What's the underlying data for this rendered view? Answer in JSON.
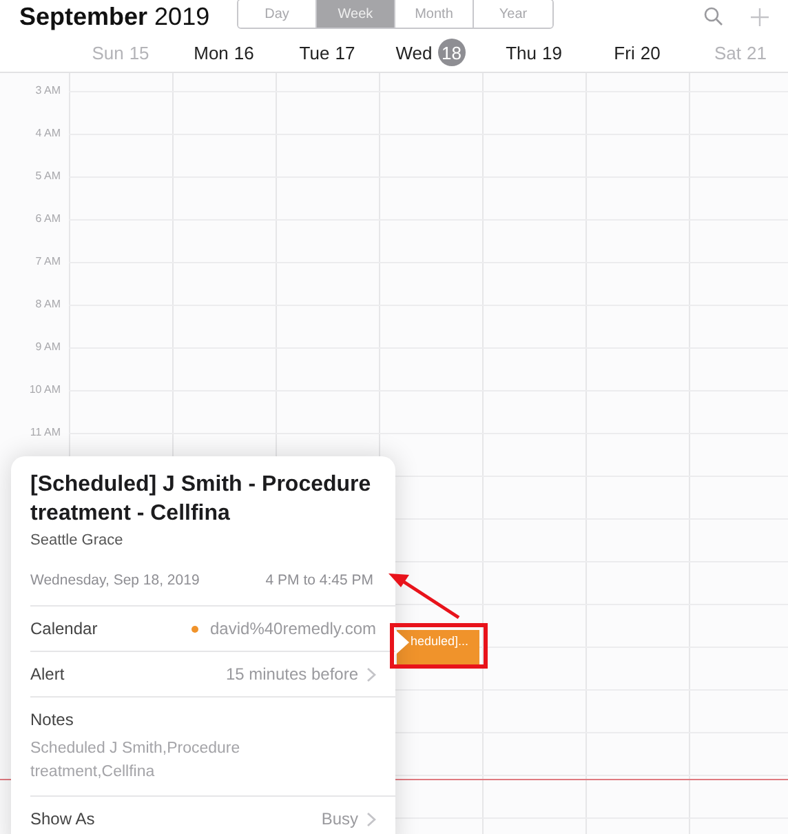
{
  "header": {
    "month": "September",
    "year": "2019",
    "views": [
      {
        "label": "Day",
        "selected": false
      },
      {
        "label": "Week",
        "selected": true
      },
      {
        "label": "Month",
        "selected": false
      },
      {
        "label": "Year",
        "selected": false
      }
    ]
  },
  "days": [
    {
      "name": "Sun",
      "date": "15",
      "weekend": true,
      "today": false
    },
    {
      "name": "Mon",
      "date": "16",
      "weekend": false,
      "today": false
    },
    {
      "name": "Tue",
      "date": "17",
      "weekend": false,
      "today": false
    },
    {
      "name": "Wed",
      "date": "18",
      "weekend": false,
      "today": true
    },
    {
      "name": "Thu",
      "date": "19",
      "weekend": false,
      "today": false
    },
    {
      "name": "Fri",
      "date": "20",
      "weekend": false,
      "today": false
    },
    {
      "name": "Sat",
      "date": "21",
      "weekend": true,
      "today": false
    }
  ],
  "hours": [
    "3 AM",
    "4 AM",
    "5 AM",
    "6 AM",
    "7 AM",
    "8 AM",
    "9 AM",
    "10 AM",
    "11 AM"
  ],
  "event": {
    "title": "heduled]...",
    "color": "#f0932b"
  },
  "popover": {
    "title": "[Scheduled] J Smith - Procedure treatment - Cellfina",
    "location": "Seattle Grace",
    "date": "Wednesday, Sep 18, 2019",
    "time": "4 PM to 4:45 PM",
    "rows": [
      {
        "kind": "calendar",
        "label": "Calendar",
        "value": "david%40remedly.com",
        "color": "#f0932b"
      },
      {
        "kind": "link",
        "label": "Alert",
        "value": "15 minutes before"
      },
      {
        "kind": "notes",
        "label": "Notes",
        "value": "Scheduled J Smith,Procedure treatment,Cellfina"
      },
      {
        "kind": "link",
        "label": "Show As",
        "value": "Busy"
      }
    ]
  }
}
